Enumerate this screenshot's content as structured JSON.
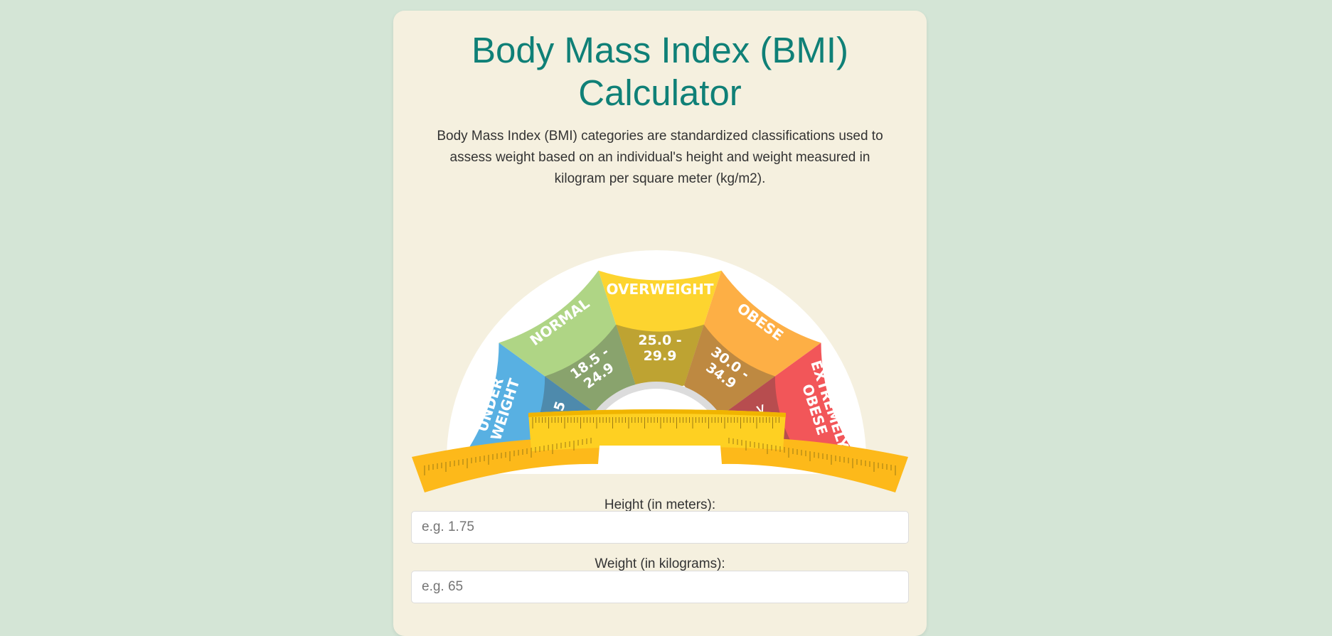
{
  "page": {
    "title": "Body Mass Index (BMI) Calculator",
    "description": "Body Mass Index (BMI) categories are standardized classifications used to assess weight based on an individual's height and weight measured in kilogram per square meter (kg/m2)."
  },
  "gauge": {
    "categories": [
      {
        "name": "UNDER WEIGHT",
        "range": "< 18.5",
        "color": "#58b0e2"
      },
      {
        "name": "NORMAL",
        "range": "18.5 - 24.9",
        "color": "#afd585"
      },
      {
        "name": "OVERWEIGHT",
        "range": "25.0 - 29.9",
        "color": "#fdd42f"
      },
      {
        "name": "OBESE",
        "range": "30.0 - 34.9",
        "color": "#fdaf45"
      },
      {
        "name": "EXTREMELY OBESE",
        "range": ">35.0",
        "color": "#f25659"
      }
    ],
    "ruler_color": "#fec92e"
  },
  "form": {
    "height_label": "Height (in meters):",
    "height_placeholder": "e.g. 1.75",
    "weight_label": "Weight (in kilograms):",
    "weight_placeholder": "e.g. 65"
  },
  "colors": {
    "background": "#d4e5d6",
    "card": "#f5f0df",
    "title": "#0f8077"
  }
}
